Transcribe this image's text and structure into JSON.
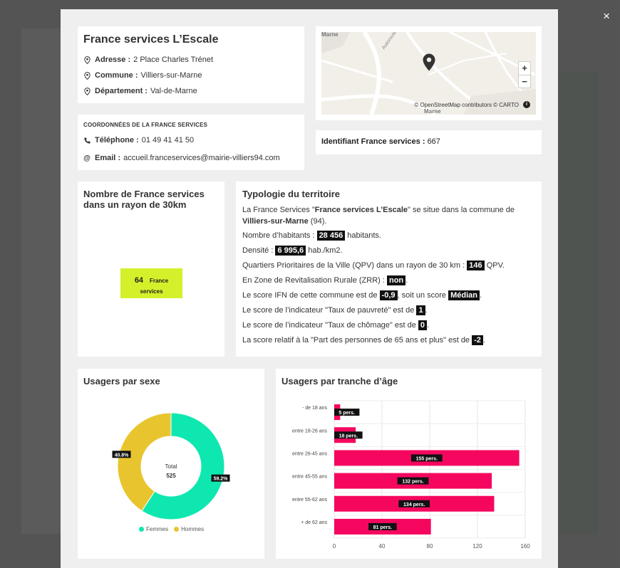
{
  "modal": {
    "close_label": "×",
    "header": {
      "title": "France services L’Escale",
      "address_label": "Adresse :",
      "address_value": "2 Place Charles Trénet",
      "commune_label": "Commune :",
      "commune_value": "Villiers-sur-Marne",
      "departement_label": "Département :",
      "departement_value": "Val-de-Marne"
    },
    "map": {
      "labels": [
        "Marne",
        "Autoroute de l’Est",
        "Marne"
      ],
      "zoom_in": "+",
      "zoom_out": "−",
      "attribution": "© OpenStreetMap contributors © CARTO",
      "info": "i"
    },
    "coords": {
      "title": "COORDONNÉES DE LA FRANCE SERVICES",
      "phone_label": "Téléphone :",
      "phone_value": "01 49 41 41 50",
      "email_label": "Email :",
      "email_value": "accueil.franceservices@mairie-villiers94.com"
    },
    "identifier": {
      "label": "Identifiant France services :",
      "value": "667"
    },
    "nearby": {
      "title": "Nombre de France services dans un rayon de 30km",
      "count": "64",
      "count_label": "France services"
    },
    "typology": {
      "title": "Typologie du territoire",
      "l1_a": "La France Services \"",
      "l1_b": "France services L’Escale",
      "l1_c": "\" se situe dans la commune de",
      "l2_a": "Villiers-sur-Marne",
      "l2_b": " (94).",
      "inhab_a": "Nombre d’habitants : ",
      "inhab_v": "28 456",
      "inhab_b": " habitants.",
      "dens_a": "Densité : ",
      "dens_v": "6 995,6",
      "dens_b": " hab./km2.",
      "qpv_a": "Quartiers Prioritaires de la Ville (QPV) dans un rayon de 30 km : ",
      "qpv_v": "146",
      "qpv_b": " QPV.",
      "zrr_a": "En Zone de Revitalisation Rurale (ZRR) : ",
      "zrr_v": "non",
      "zrr_b": ".",
      "ifn_a": "Le score IFN de cette commune est de ",
      "ifn_v": "-0,9",
      "ifn_b": ", soit un score ",
      "ifn_v2": "Médian",
      "ifn_c": ".",
      "pauv_a": "Le score de l’indicateur \"Taux de pauvreté\" est de ",
      "pauv_v": "1",
      "pauv_b": ".",
      "chom_a": "Le score de l’indicateur \"Taux de chômage\" est de ",
      "chom_v": "0",
      "chom_b": ".",
      "age_a": "La score relatif à la \"Part des personnes de 65 ans et plus\" est de ",
      "age_v": "-2",
      "age_b": "."
    },
    "sex_chart_title": "Usagers par sexe",
    "age_chart_title": "Usagers par tranche d’âge"
  },
  "chart_data": [
    {
      "type": "pie",
      "title": "Usagers par sexe",
      "center_label": "Total",
      "center_value": "525",
      "labels": [
        "Femmes",
        "Hommes"
      ],
      "values": [
        59.2,
        40.8
      ],
      "value_labels": [
        "59.2%",
        "40.8%"
      ],
      "colors": [
        "#0ee8b0",
        "#e8c52f"
      ],
      "legend": "bottom"
    },
    {
      "type": "bar",
      "orientation": "horizontal",
      "title": "Usagers par tranche d’âge",
      "categories": [
        "- de 18 ans",
        "entre 18-26 ans",
        "entre 26-45 ans",
        "entre 45-55 ans",
        "entre 55-62 ans",
        "+ de 62 ans"
      ],
      "values": [
        5,
        18,
        155,
        132,
        134,
        81
      ],
      "value_labels": [
        "5 pers.",
        "18 pers.",
        "155 pers.",
        "132 pers.",
        "134 pers.",
        "81 pers."
      ],
      "xlim": [
        0,
        160
      ],
      "xticks": [
        "0",
        "40",
        "80",
        "120",
        "160"
      ],
      "color": "#f5075f",
      "grid": true
    }
  ]
}
